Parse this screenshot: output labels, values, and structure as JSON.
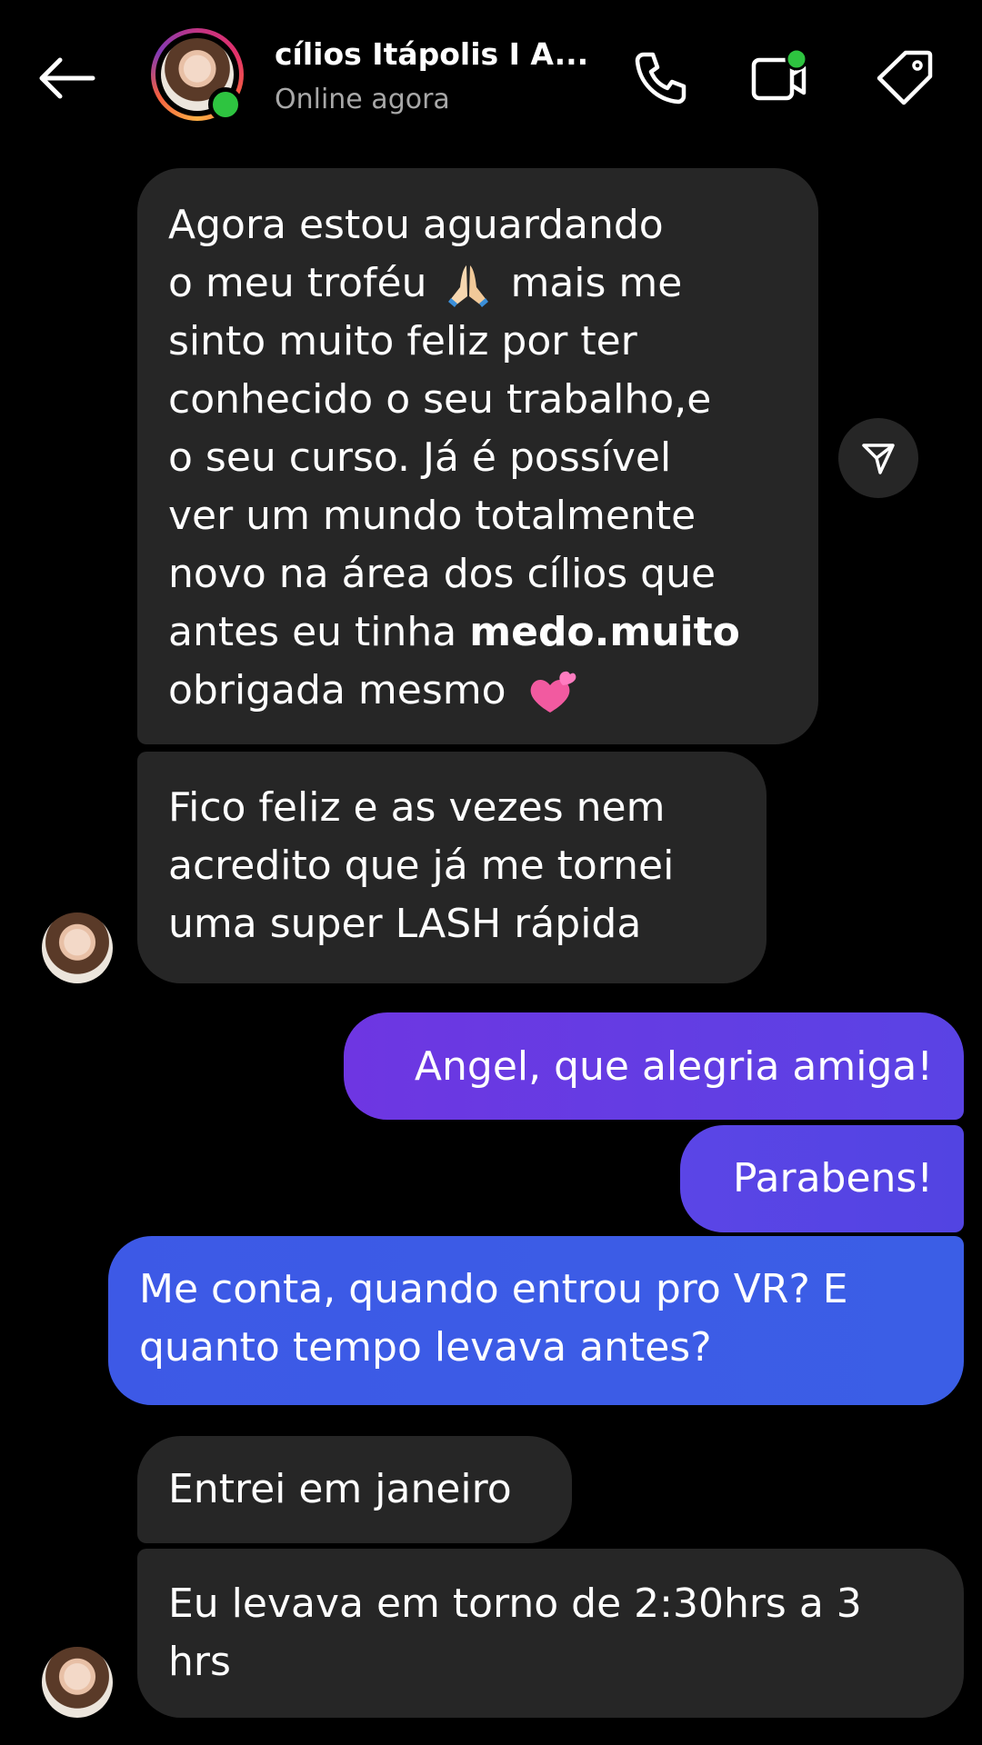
{
  "header": {
    "contact_name": "cílios Itápolis I A...",
    "status": "Online agora",
    "icons": {
      "back": "arrow-left-icon",
      "call": "phone-icon",
      "video": "video-camera-icon",
      "tag": "tag-icon"
    }
  },
  "messages": [
    {
      "direction": "incoming",
      "lines": [
        "Agora estou aguardando",
        "o meu troféu",
        "mais me",
        "sinto muito feliz por ter",
        "conhecido o seu trabalho,e",
        "o seu curso. Já é possível",
        "ver um mundo totalmente",
        "novo na área dos cílios que",
        "antes eu tinha",
        "medo.muito",
        "obrigada mesmo"
      ],
      "emojis": [
        "praying-hands-emoji",
        "two-hearts-emoji"
      ]
    },
    {
      "direction": "incoming",
      "text": "Fico feliz e as vezes nem\nacredito que já me tornei\numa super LASH rápida"
    },
    {
      "direction": "outgoing",
      "text": "Angel, que alegria amiga!"
    },
    {
      "direction": "outgoing",
      "text": "Parabens!"
    },
    {
      "direction": "outgoing",
      "text": "Me conta, quando entrou pro VR? E\nquanto tempo levava antes?"
    },
    {
      "direction": "incoming",
      "text": "Entrei em janeiro"
    },
    {
      "direction": "incoming",
      "text": "Eu levava em torno de 2:30hrs a 3\nhrs"
    }
  ],
  "colors": {
    "background": "#000000",
    "incoming_bubble": "#262626",
    "outgoing_gradient_top": "#6e36e2",
    "outgoing_gradient_bottom": "#3b5ee6",
    "online_dot": "#2ec440",
    "status_text": "#a8a8a8"
  }
}
